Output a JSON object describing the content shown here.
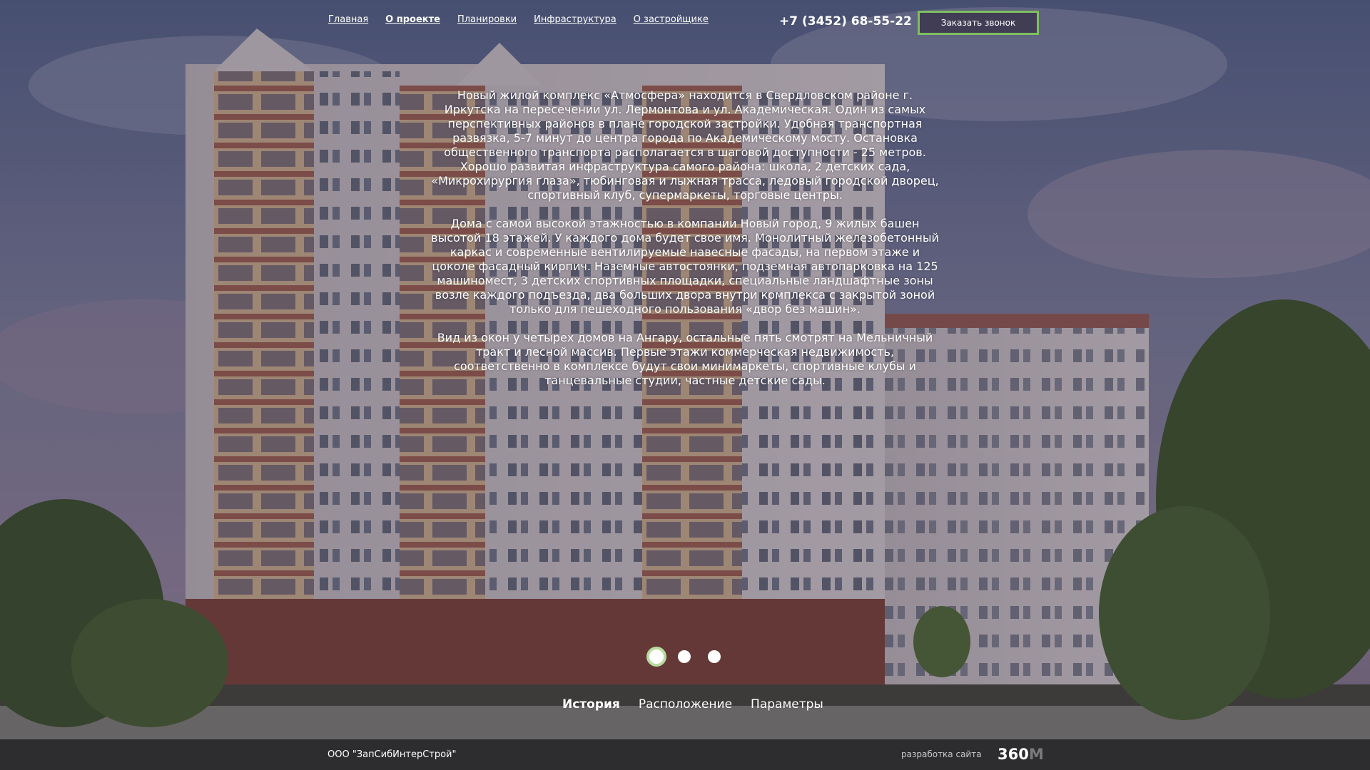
{
  "nav": {
    "items": [
      {
        "label": "Главная",
        "active": false
      },
      {
        "label": "О проекте",
        "active": true
      },
      {
        "label": "Планировки",
        "active": false
      },
      {
        "label": "Инфраструктура",
        "active": false
      },
      {
        "label": "О застройщике",
        "active": false
      }
    ]
  },
  "header": {
    "phone": "+7 (3452) 68-55-22",
    "callback_label": "Заказать звонок"
  },
  "content": {
    "paragraphs": [
      "Новый жилой комплекс «Атмосфера» находится в Свердловском районе г. Иркутска на пересечении ул. Лермонтова и ул. Академическая. Один из самых перспективных районов в плане городской застройки. Удобная транспортная развязка, 5-7 минут до центра города по Академическому мосту. Остановка общественного транспорта располагается в шаговой доступности - 25 метров. Хорошо развитая инфраструктура самого района: школа, 2 детских сада, «Микрохирургия глаза», тюбинговая и лыжная трасса, ледовый городской дворец, спортивный клуб, супермаркеты, торговые центры.",
      "Дома с самой высокой этажностью в компании Новый город, 9 жилых башен высотой 18 этажей. У каждого дома будет свое имя. Монолитный железобетонный каркас и современные вентилируемые навесные фасады, на первом этаже и цоколе фасадный кирпич. Наземные автостоянки, подземная автопарковка на 125 машиномест, 3 детских спортивных площадки, специальные ландшафтные зоны возле каждого подъезда, два больших двора внутри комплекса с закрытой зоной только для пешеходного пользования «двор без машин».",
      "Вид из окон у четырех домов на Ангару, остальные пять смотрят на Мельничный тракт и лесной массив. Первые этажи коммерческая недвижимость, соответственно в комплексе будут свои минимаркеты, спортивные клубы и танцевальные студии, частные детские сады."
    ]
  },
  "slider": {
    "slide_count": 3,
    "active_index": 0
  },
  "tabs": [
    {
      "label": "История",
      "active": true
    },
    {
      "label": "Расположение",
      "active": false
    },
    {
      "label": "Параметры",
      "active": false
    }
  ],
  "footer": {
    "company": "ООО \"ЗапСибИнтерСтрой\"",
    "dev_label": "разработка сайта",
    "dev_logo_main": "360",
    "dev_logo_suffix": "M"
  },
  "colors": {
    "accent": "#7fbf5f",
    "dot_active_ring": "#b8dca0",
    "footer_bg": "#2d2d2f"
  }
}
